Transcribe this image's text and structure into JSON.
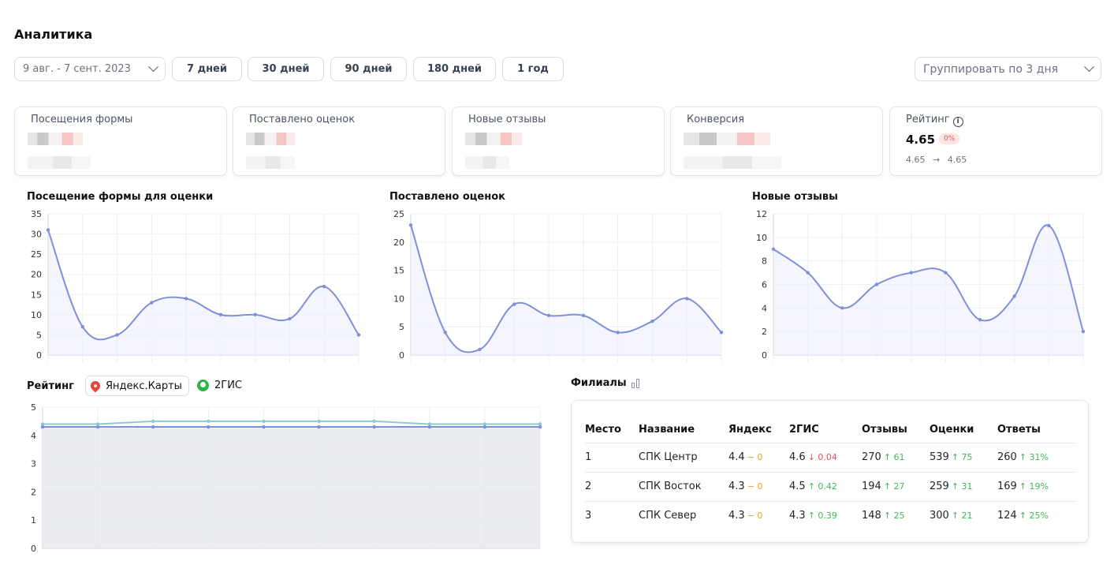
{
  "page": {
    "title": "Аналитика"
  },
  "filters": {
    "date_range": "9 авг. - 7 сент. 2023",
    "periods": [
      "7 дней",
      "30 дней",
      "90 дней",
      "180 дней",
      "1 год"
    ],
    "group_by": "Группировать по 3 дня"
  },
  "kpis": [
    {
      "label": "Посещения формы"
    },
    {
      "label": "Поставлено оценок"
    },
    {
      "label": "Новые отзывы"
    },
    {
      "label": "Конверсия"
    }
  ],
  "rating_card": {
    "label": "Рейтинг",
    "value": "4.65",
    "change": "0%",
    "from": "4.65",
    "to": "4.65",
    "arrow": "→"
  },
  "chart_titles": {
    "visits": "Посещение формы для оценки",
    "ratings": "Поставлено оценок",
    "reviews": "Новые отзывы",
    "rating": "Рейтинг"
  },
  "chart_data": [
    {
      "type": "area",
      "title": "Посещение формы для оценки",
      "ylim": [
        0,
        35
      ],
      "yticks": [
        0,
        5,
        10,
        15,
        20,
        25,
        30,
        35
      ],
      "series": [
        {
          "values": [
            31,
            7,
            5,
            13,
            14,
            10,
            10,
            9,
            17,
            5
          ]
        }
      ],
      "grid": true,
      "color": "#7f8fd8"
    },
    {
      "type": "area",
      "title": "Поставлено оценок",
      "ylim": [
        0,
        25
      ],
      "yticks": [
        0,
        5,
        10,
        15,
        20,
        25
      ],
      "series": [
        {
          "values": [
            23,
            4,
            1,
            9,
            7,
            7,
            4,
            6,
            10,
            4
          ]
        }
      ],
      "grid": true,
      "color": "#7f8fd8"
    },
    {
      "type": "area",
      "title": "Новые отзывы",
      "ylim": [
        0,
        12
      ],
      "yticks": [
        0,
        2,
        4,
        6,
        8,
        10,
        12
      ],
      "series": [
        {
          "values": [
            9,
            7,
            4,
            6,
            7,
            7,
            3,
            5,
            11,
            2
          ]
        }
      ],
      "grid": true,
      "color": "#7f8fd8"
    },
    {
      "type": "area",
      "title": "Рейтинг",
      "ylim": [
        0,
        5
      ],
      "yticks": [
        0,
        1,
        2,
        3,
        4,
        5
      ],
      "series": [
        {
          "name": "Яндекс.Карты",
          "values": [
            4.3,
            4.3,
            4.3,
            4.3,
            4.3,
            4.3,
            4.3,
            4.3,
            4.3,
            4.3
          ],
          "color": "#7f8fd8"
        },
        {
          "name": "2ГИС",
          "values": [
            4.4,
            4.4,
            4.5,
            4.5,
            4.5,
            4.5,
            4.5,
            4.4,
            4.4,
            4.4
          ],
          "color": "#8ec9d0"
        }
      ],
      "grid": true
    }
  ],
  "legend": {
    "yandex": "Яндекс.Карты",
    "gis": "2ГИС"
  },
  "branches": {
    "title": "Филиалы",
    "headers": [
      "Место",
      "Название",
      "Яндекс",
      "2ГИС",
      "Отзывы",
      "Оценки",
      "Ответы"
    ],
    "rows": [
      {
        "place": "1",
        "name": "СПК Центр",
        "yandex": "4.4",
        "yandex_d": "− 0",
        "yandex_t": "flat",
        "gis": "4.6",
        "gis_d": "↓ 0.04",
        "gis_t": "down",
        "reviews": "270",
        "reviews_d": "↑ 61",
        "ratings": "539",
        "ratings_d": "↑ 75",
        "answers": "260",
        "answers_d": "↑ 31%"
      },
      {
        "place": "2",
        "name": "СПК Восток",
        "yandex": "4.3",
        "yandex_d": "− 0",
        "yandex_t": "flat",
        "gis": "4.5",
        "gis_d": "↑ 0.42",
        "gis_t": "up",
        "reviews": "194",
        "reviews_d": "↑ 27",
        "ratings": "259",
        "ratings_d": "↑ 31",
        "answers": "169",
        "answers_d": "↑ 19%"
      },
      {
        "place": "3",
        "name": "СПК Север",
        "yandex": "4.3",
        "yandex_d": "− 0",
        "yandex_t": "flat",
        "gis": "4.3",
        "gis_d": "↑ 0.39",
        "gis_t": "up",
        "reviews": "148",
        "reviews_d": "↑ 25",
        "ratings": "300",
        "ratings_d": "↑ 21",
        "answers": "124",
        "answers_d": "↑ 25%"
      }
    ]
  }
}
